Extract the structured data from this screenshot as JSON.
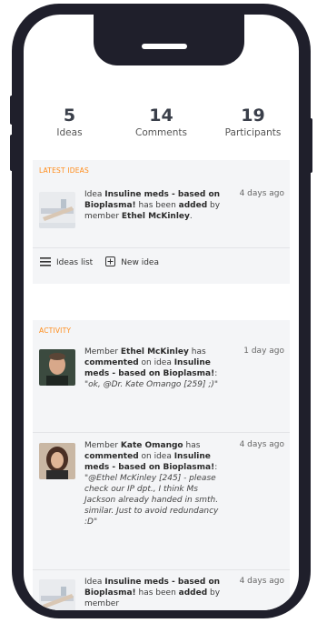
{
  "stats": [
    {
      "value": "5",
      "label": "Ideas"
    },
    {
      "value": "14",
      "label": "Comments"
    },
    {
      "value": "19",
      "label": "Participants"
    }
  ],
  "latest_ideas": {
    "title": "LATEST IDEAS",
    "item": {
      "p1": "Idea ",
      "idea": "Insuline meds - based on Bioplasma!",
      "p2": " has been ",
      "action": "added",
      "p3": " by member ",
      "member": "Ethel McKinley",
      "p4": ".",
      "time": "4 days ago"
    },
    "ideas_list_label": "Ideas list",
    "new_idea_label": "New idea"
  },
  "activity": {
    "title": "ACTIVITY",
    "items": [
      {
        "p1": "Member ",
        "member": "Ethel McKinley",
        "p2": " has ",
        "action": "commented",
        "p3": " on idea ",
        "idea": "Insuline meds - based on Bioplasma!",
        "p4": ":",
        "quote": "\"ok, @Dr. Kate Omango [259] ;)\"",
        "time": "1 day ago"
      },
      {
        "p1": "Member ",
        "member": "Kate Omango",
        "p2": " has ",
        "action": "commented",
        "p3": " on idea ",
        "idea": "Insuline meds - based on Bioplasma!",
        "p4": ":",
        "quote": "\"@Ethel McKinley [245] - please check our IP dpt., I think Ms Jackson already handed in smth. similar. Just to avoid redundancy :D\"",
        "time": "4 days ago"
      },
      {
        "p1": "Idea ",
        "idea": "Insuline meds - based on Bioplasma!",
        "p2": " has been ",
        "action": "added",
        "p3": " by member",
        "time": "4 days ago"
      }
    ]
  },
  "colors": {
    "accent": "#ff8c1a",
    "frame": "#1f1f2b",
    "band": "#f4f5f7"
  }
}
